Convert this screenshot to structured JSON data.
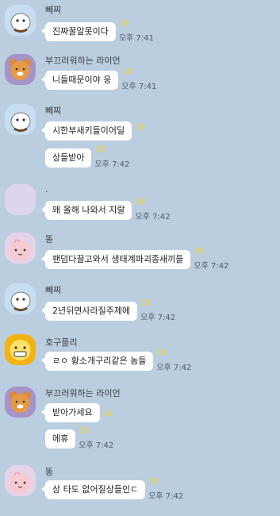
{
  "messages": [
    {
      "sender": "빼찌",
      "avatar": "white-character-icon",
      "lines": [
        {
          "text": "진짜꿀알못이다",
          "unread": "18",
          "time": "오후 7:41"
        }
      ]
    },
    {
      "sender": "부끄러워하는 라이언",
      "avatar": "ryan-lion-icon",
      "lines": [
        {
          "text": "니들때문이야 응",
          "unread": "18",
          "time": "오후 7:41"
        }
      ]
    },
    {
      "sender": "빼찌",
      "avatar": "white-character-icon",
      "lines": [
        {
          "text": "시한부새키들이어딜",
          "unread": "18",
          "time": ""
        },
        {
          "text": "상들받아",
          "unread": "18",
          "time": "오후 7:42"
        }
      ]
    },
    {
      "sender": ".",
      "avatar": "blank-profile-icon",
      "lines": [
        {
          "text": "왜 올해 나와서 지랄",
          "unread": "18",
          "time": "오후 7:42"
        }
      ]
    },
    {
      "sender": "똥",
      "avatar": "apeach-icon",
      "lines": [
        {
          "text": "팬덤다끌고와서 생태계파괴종새끼들",
          "unread": "18",
          "time": "오후 7:42"
        }
      ]
    },
    {
      "sender": "빼찌",
      "avatar": "white-character-icon",
      "lines": [
        {
          "text": "2년뒤면사라질주제에",
          "unread": "18",
          "time": "오후 7:42"
        }
      ]
    },
    {
      "sender": "호구플리",
      "avatar": "yellow-character-icon",
      "lines": [
        {
          "text": "ㄹㅇ 황소개구리같은 놈들",
          "unread": "18",
          "time": "오후 7:42"
        }
      ]
    },
    {
      "sender": "부끄러워하는 라이언",
      "avatar": "ryan-lion-icon",
      "lines": [
        {
          "text": "받아가세요",
          "unread": "18",
          "time": ""
        },
        {
          "text": "에휴",
          "unread": "18",
          "time": "오후 7:42"
        }
      ]
    },
    {
      "sender": "똥",
      "avatar": "apeach-icon",
      "lines": [
        {
          "text": "상 타도 없어질상들인ㄷ",
          "unread": "18",
          "time": "오후 7:42"
        }
      ]
    }
  ]
}
